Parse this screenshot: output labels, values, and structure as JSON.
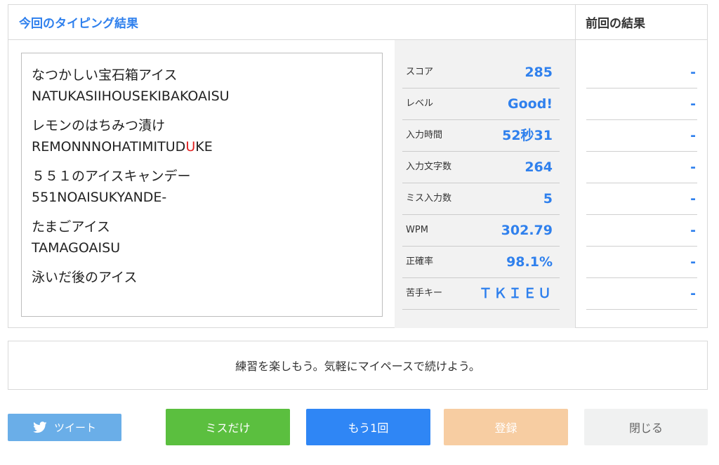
{
  "header": {
    "current_title": "今回のタイピング結果",
    "previous_title": "前回の結果"
  },
  "words": [
    {
      "jp": "なつかしい宝石箱アイス",
      "romaji_before": "NATUKASIIHOUSEKIBAKOAISU",
      "romaji_error": "",
      "romaji_after": ""
    },
    {
      "jp": "レモンのはちみつ漬け",
      "romaji_before": "REMONNNOHATIMITUD",
      "romaji_error": "U",
      "romaji_after": "KE"
    },
    {
      "jp": "５５１のアイスキャンデー",
      "romaji_before": "551NOAISUKYANDE-",
      "romaji_error": "",
      "romaji_after": ""
    },
    {
      "jp": "たまごアイス",
      "romaji_before": "TAMAGOAISU",
      "romaji_error": "",
      "romaji_after": ""
    },
    {
      "jp": "泳いだ後のアイス",
      "romaji_before": "",
      "romaji_error": "",
      "romaji_after": ""
    }
  ],
  "stats": [
    {
      "label": "スコア",
      "value": "285"
    },
    {
      "label": "レベル",
      "value": "Good!"
    },
    {
      "label": "入力時間",
      "value": "52秒31"
    },
    {
      "label": "入力文字数",
      "value": "264"
    },
    {
      "label": "ミス入力数",
      "value": "5"
    },
    {
      "label": "WPM",
      "value": "302.79"
    },
    {
      "label": "正確率",
      "value": "98.1%"
    },
    {
      "label": "苦手キー",
      "value": "ＴＫＩＥＵ"
    }
  ],
  "previous": [
    "-",
    "-",
    "-",
    "-",
    "-",
    "-",
    "-",
    "-"
  ],
  "message": "練習を楽しもう。気軽にマイペースで続けよう。",
  "buttons": {
    "tweet": "ツイート",
    "miss_only": "ミスだけ",
    "again": "もう1回",
    "register": "登録",
    "close": "閉じる"
  },
  "icons": {
    "tweet": "twitter-bird-icon"
  },
  "colors": {
    "accent_blue": "#2f80ed",
    "error_red": "#e02020",
    "tweet_button": "#6aaee8",
    "miss_button": "#5bbf3f",
    "again_button": "#2f86f5",
    "register_button": "#f7cda2",
    "close_button": "#f0f1f1"
  }
}
